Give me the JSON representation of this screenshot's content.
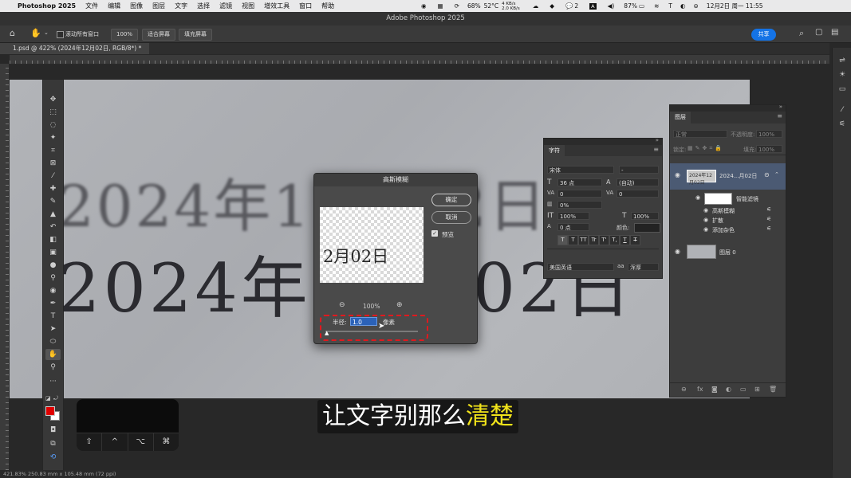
{
  "menubar": {
    "app": "Photoshop 2025",
    "items": [
      "文件",
      "编辑",
      "图像",
      "图层",
      "文字",
      "选择",
      "滤镜",
      "视图",
      "增效工具",
      "窗口",
      "帮助"
    ],
    "net_up": "4 KB/s",
    "net_down": "2.0 KB/s",
    "cpu_pct": "68%",
    "temp": "52°C",
    "wechat_count": "2",
    "battery": "87%",
    "datetime": "12月2日 周一 11:55"
  },
  "window": {
    "title": "Adobe Photoshop 2025"
  },
  "options": {
    "scroll_all": "滚动所有窗口",
    "zoom": "100%",
    "fit_screen": "适合屏幕",
    "fill_screen": "填充屏幕",
    "share": "共享"
  },
  "document": {
    "tab": "1.psd @ 422% (2024年12月02日, RGB/8*) *"
  },
  "canvas": {
    "line1": "2024年12月02日",
    "line2": "2024年12月02日"
  },
  "dialog": {
    "title": "高斯模糊",
    "ok": "确定",
    "cancel": "取消",
    "preview_label": "预览",
    "preview_text": "2月02日",
    "zoom": "100%",
    "radius_label": "半径:",
    "radius_value": "1.0",
    "unit": "像素"
  },
  "character": {
    "tab": "字符",
    "font_family": "宋体",
    "font_style": "-",
    "size": "36 点",
    "leading": "(自动)",
    "kerning": "0",
    "tracking": "0",
    "tsume": "0%",
    "vscale": "100%",
    "hscale": "100%",
    "baseline": "0 点",
    "color_label": "颜色:",
    "language": "美国英语",
    "aa": "浑厚",
    "aa_prefix": "aa",
    "type_buttons": [
      "T",
      "T",
      "TT",
      "Tr",
      "T'",
      "T,",
      "T",
      "T"
    ]
  },
  "layers": {
    "tab": "图层",
    "blend_mode": "正常",
    "opacity_label": "不透明度:",
    "opacity": "100%",
    "lock_label": "锁定:",
    "fill_label": "填充:",
    "fill": "100%",
    "text_layer": "2024...月02日",
    "smart_filters": "智能滤镜",
    "filters": [
      "高斯模糊",
      "扩散",
      "添加杂色"
    ],
    "bg_layer": "图层 0"
  },
  "keypad": {
    "keys": [
      "⇧",
      "^",
      "⌥",
      "⌘"
    ]
  },
  "subtitle": {
    "before": "让文字别那么",
    "highlight": "清楚"
  },
  "status": {
    "text": "421.83%   250.83 mm x 105.48 mm (72 ppi)"
  },
  "colors": {
    "accent": "#1473e6",
    "foreground": "#e00000",
    "highlight": "#f2e41a",
    "annotation": "#e0191e"
  }
}
